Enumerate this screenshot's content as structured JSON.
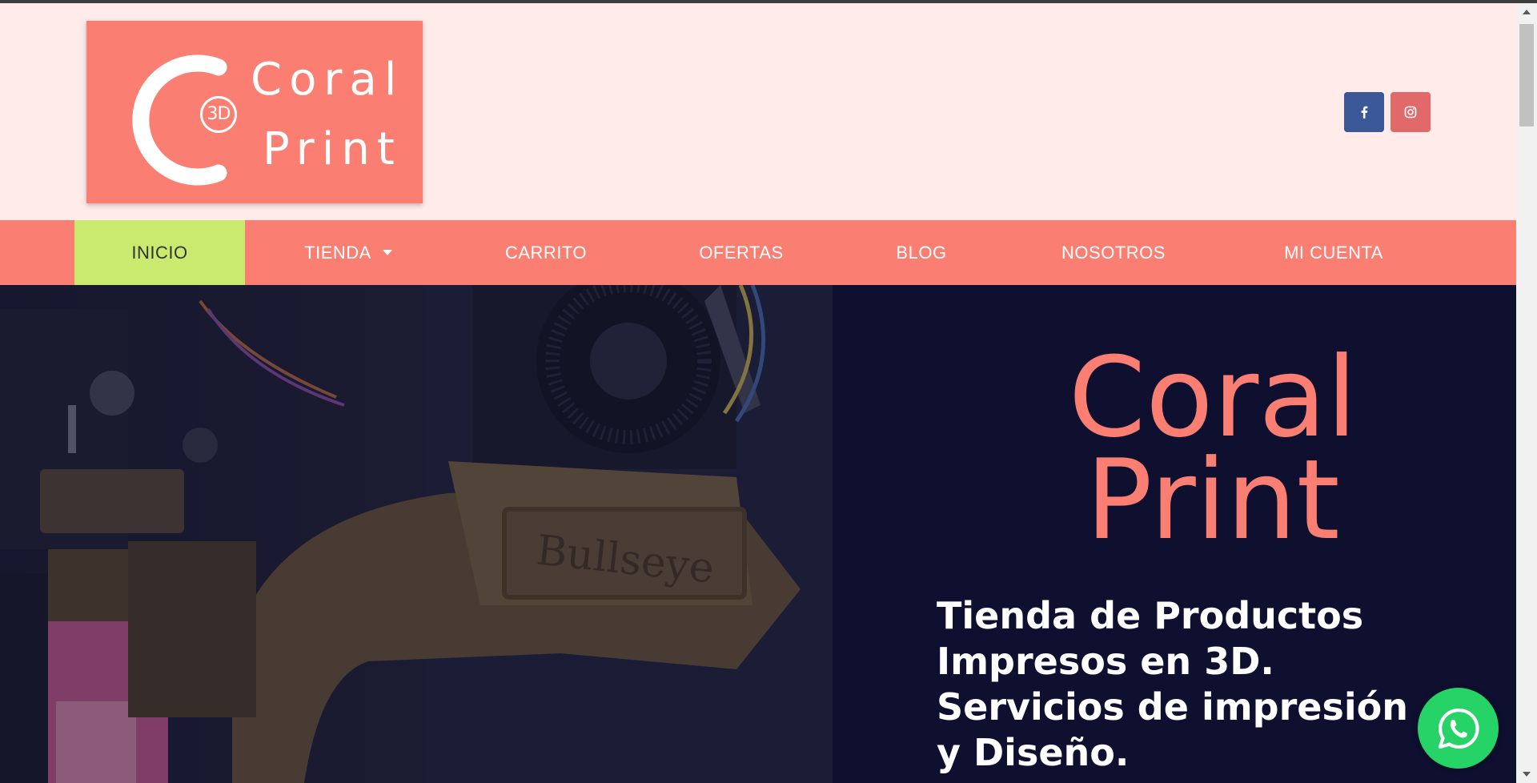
{
  "logo": {
    "line1": "Coral",
    "line2": "Print",
    "badge": "3D",
    "icon": "c-3d-logo"
  },
  "social": {
    "facebook_icon": "facebook-icon",
    "instagram_icon": "instagram-icon"
  },
  "nav": {
    "items": [
      {
        "label": "INICIO",
        "active": true
      },
      {
        "label": "TIENDA",
        "has_dropdown": true
      },
      {
        "label": "CARRITO"
      },
      {
        "label": "OFERTAS"
      },
      {
        "label": "BLOG"
      },
      {
        "label": "NOSOTROS"
      },
      {
        "label": "MI CUENTA"
      }
    ]
  },
  "hero": {
    "title_line1": "Coral",
    "title_line2": "Print",
    "subtitle": "Tienda de Productos Impresos en 3D. Servicios de impresión y Diseño.",
    "photo_text": "Bullseye"
  },
  "whatsapp": {
    "icon": "whatsapp-icon"
  },
  "colors": {
    "coral": "#fa7f72",
    "header_bg": "#ffecea",
    "active_nav": "#c9ea6f",
    "hero_bg": "#0f1030",
    "facebook": "#3b5998",
    "instagram": "#e2696a",
    "whatsapp": "#25d366"
  }
}
